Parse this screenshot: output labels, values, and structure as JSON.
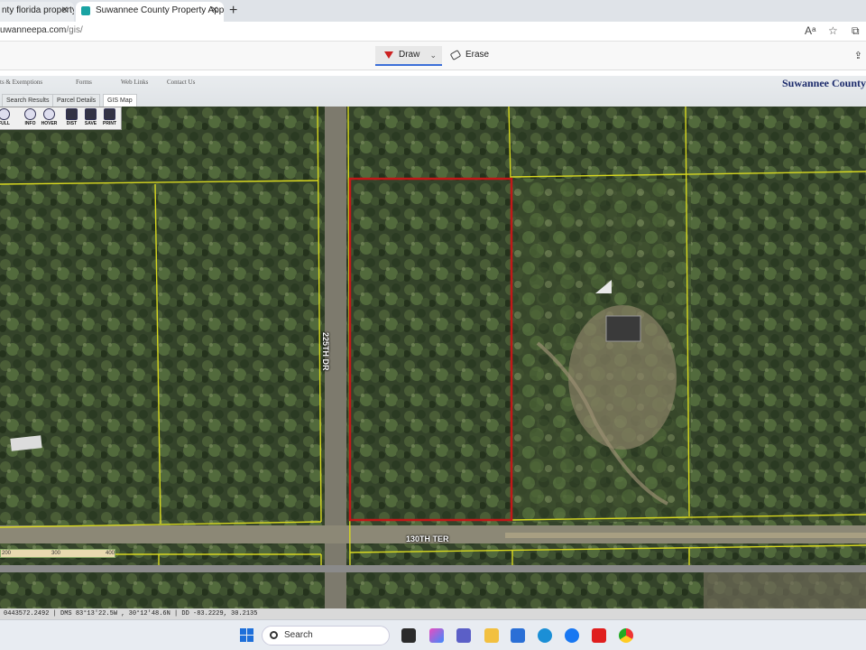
{
  "browser": {
    "tabs": [
      {
        "label": "nty florida property",
        "active": false
      },
      {
        "label": "Suwannee County Property Appra",
        "active": true
      }
    ],
    "new_tab": "+",
    "url_host": "uwanneepa.com",
    "url_path": "/gis/"
  },
  "draw_toolbar": {
    "draw_label": "Draw",
    "erase_label": "Erase"
  },
  "site": {
    "title": "Suwannee County",
    "nav": [
      "ts & Exemptions",
      "Forms",
      "Web Links",
      "Contact Us"
    ],
    "subtabs": [
      {
        "label": "Search Results",
        "active": false
      },
      {
        "label": "Parcel Details",
        "active": false
      },
      {
        "label": "GIS Map",
        "active": true
      }
    ]
  },
  "gis_tools": [
    "FULL",
    "INFO",
    "HOVER",
    "DIST",
    "SAVE",
    "PRINT"
  ],
  "map": {
    "road_vertical": "225TH DR",
    "road_horizontal": "130TH TER",
    "scale_top": [
      "200",
      "300",
      "400"
    ],
    "scale_bottom": [
      "200",
      "300"
    ],
    "parcel_color": "#c01818",
    "lot_line_color": "#d8d820"
  },
  "status_text": "0443572.2492 | DMS 83°13'22.5W , 30°12'48.6N | DD -83.2229, 30.2135",
  "taskbar": {
    "search_label": "Search"
  },
  "colors": {
    "accent": "#3b6fd8",
    "site_title": "#1b2a6b"
  }
}
